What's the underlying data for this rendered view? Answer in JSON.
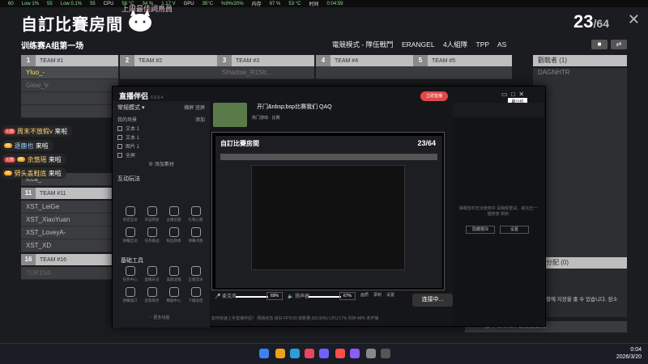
{
  "osd": {
    "items": [
      "60",
      "Low 1%",
      "55",
      "Low 0.1%",
      "55",
      "CPU",
      "58 °C",
      "34 %",
      "1.17 V",
      "GPU",
      "35°C",
      "%9%/20%",
      "内存",
      "67 %",
      "53 °C",
      "时间",
      "0:04:59"
    ]
  },
  "header": {
    "room_title": "自訂比賽房間",
    "deco_text": "上周最佳詞鳥員",
    "count": "23",
    "count_max": "/64",
    "match_name": "训练赛A组第一场",
    "mode": "電競模式 - 隊伍戰鬥",
    "map": "ERANGEL",
    "squad": "4人組隊",
    "perspective": "TPP",
    "region": "AS",
    "lock_icon": "lock-icon",
    "swap_icon": "swap-icon"
  },
  "teams": [
    {
      "num": "1",
      "name": "TEAM #1",
      "slots": [
        "Yluo_-",
        "Glow_V",
        "",
        ""
      ]
    },
    {
      "num": "2",
      "name": "TEAM #2",
      "slots": [
        "",
        "",
        "",
        ""
      ]
    },
    {
      "num": "3",
      "name": "TEAM #3",
      "slots": [
        "SHadow_R1Str...",
        "",
        "",
        ""
      ]
    },
    {
      "num": "4",
      "name": "TEAM #4",
      "slots": [
        "",
        "",
        "",
        ""
      ]
    },
    {
      "num": "5",
      "name": "TEAM #5",
      "slots": [
        "",
        "",
        "",
        ""
      ]
    }
  ],
  "observers": {
    "title": "觀戰者 (1)",
    "slot": "DAGNHTR"
  },
  "team11": {
    "num": "11",
    "name": "TEAM #11",
    "slots": [
      "XST_LeiGe",
      "XST_XiaoYuan",
      "XST_LoveyA-",
      "XST_XD"
    ]
  },
  "team16": {
    "num": "16",
    "name": "TEAM #16",
    "slots": [
      "7UR1N4"
    ]
  },
  "team_partial": {
    "slot": "Icca_"
  },
  "chat": [
    {
      "badge": "火箭",
      "lv": "",
      "user": "周末不放假v",
      "msg": "来啦"
    },
    {
      "badge": "",
      "lv": "40",
      "user": "逐鹿也",
      "msg": "来啦"
    },
    {
      "badge": "火箭",
      "lv": "40",
      "user": "余悠瑶",
      "msg": "来啦"
    },
    {
      "badge": "",
      "lv": "35",
      "user": "劈头盖鞋底",
      "msg": "来啦"
    }
  ],
  "assign": {
    "title": "分配 (0)",
    "korean": "생활에 지장을 줄 수 있습니다. 잠소"
  },
  "chat_input": "按下 ENTER 键发送聊天",
  "app": {
    "name": "直播伴侣",
    "version": "6.5.6.4",
    "live_btn": "立即直播",
    "tooltip": "最小化",
    "stream_title": "开门&nbsp;bsp比赛我们 QAQ",
    "stream_sub": "热门游戏 · 比赛",
    "sidebar_title": "常规模式",
    "sidebar_tab1": "横屏",
    "sidebar_tab2": "竖屏",
    "scene_label": "我的场景",
    "scene_action": "添加",
    "sources": [
      "文本 1",
      "文本 1",
      "图片 1",
      "全屏"
    ],
    "add_source": "添加素材",
    "interact_title": "互动玩法",
    "interact_tools": [
      "语音互动",
      "幸运转盘",
      "主播答题",
      "礼物心愿",
      "弹幕互动",
      "任务挑战",
      "粉丝勋章",
      "弹幕点歌"
    ],
    "basic_title": "基础工具",
    "basic_tools": [
      "任务中心",
      "直播日记",
      "美颜滤镜",
      "正版音乐",
      "弹幕窗口",
      "房管助手",
      "数据中心",
      "下播总结"
    ],
    "more_tools": "更多功能",
    "mic_label": "麦克风",
    "mic_value": "69%",
    "speaker_label": "扬声器",
    "speaker_value": "67%",
    "ctrl1": "画质",
    "ctrl2": "录制",
    "ctrl3": "设置",
    "start_btn": "连接中...",
    "side_msg": "弹幕暂时无法使用中 请稍候重试，或点击一键修复 刷新",
    "side_btn1": "隐藏模块",
    "side_btn2": "设置",
    "status": "如何快速上手直播伴侣？        网络状态 良好   FPS:60   帧数量:0(0.00%)   CPU:17%   内存:48%   未开播"
  },
  "taskbar": {
    "clock_time": "0:04",
    "clock_date": "2026/3/20"
  }
}
